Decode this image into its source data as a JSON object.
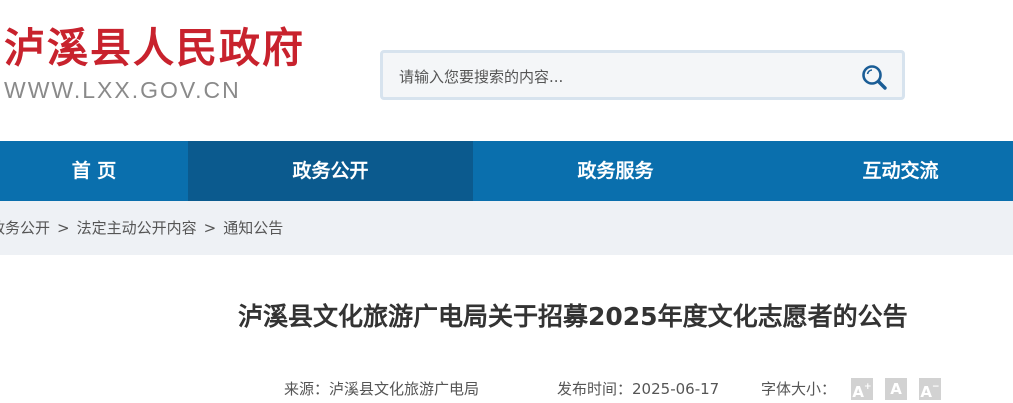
{
  "site": {
    "title": "泸溪县人民政府",
    "domain": "WWW.LXX.GOV.CN",
    "title_color": "#c8222d"
  },
  "search": {
    "placeholder": "请输入您要搜索的内容...",
    "icon": "search-icon"
  },
  "nav": {
    "items": [
      {
        "label": "首  页",
        "active": false
      },
      {
        "label": "政务公开",
        "active": true
      },
      {
        "label": "政务服务",
        "active": false
      },
      {
        "label": "互动交流",
        "active": false
      }
    ],
    "bg_color": "#0a6fad",
    "active_color": "#0b5a8e"
  },
  "breadcrumb": {
    "items": [
      "政务公开",
      "法定主动公开内容",
      "通知公告"
    ],
    "separator": ">"
  },
  "article": {
    "title": "泸溪县文化旅游广电局关于招募2025年度文化志愿者的公告",
    "source_label": "来源：",
    "source_value": "泸溪县文化旅游广电局",
    "date_label": "发布时间：",
    "date_value": "2025-06-17",
    "font_size_label": "字体大小：",
    "font_sizes": [
      "A",
      "A",
      "A"
    ]
  }
}
